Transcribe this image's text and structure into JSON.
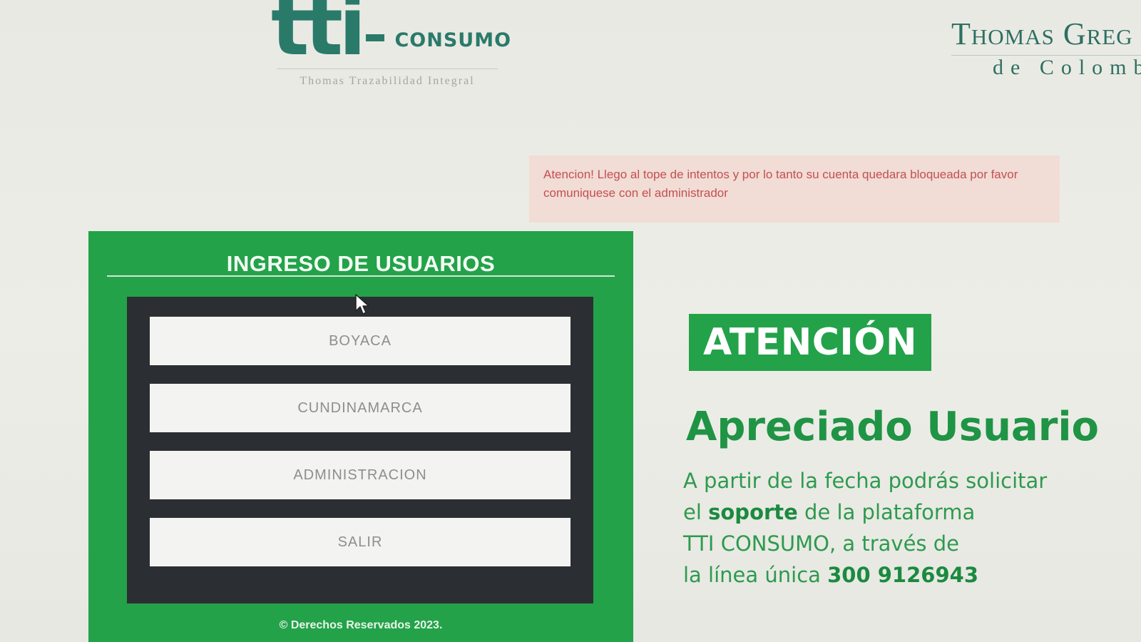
{
  "header": {
    "logo_main": "tti",
    "logo_product": "CONSUMO",
    "logo_subtitle": "Thomas Trazabilidad Integral",
    "company_name": "Thomas Greg",
    "company_sub": "de Colomb"
  },
  "alert": {
    "message": "Atencion! Llego al tope de intentos y por lo tanto su cuenta quedara bloqueada por favor comuniquese con el administrador"
  },
  "login": {
    "title": "INGRESO DE USUARIOS",
    "buttons": [
      {
        "label": "BOYACA"
      },
      {
        "label": "CUNDINAMARCA"
      },
      {
        "label": "ADMINISTRACION"
      },
      {
        "label": "SALIR"
      }
    ],
    "footer": "© Derechos Reservados 2023."
  },
  "notice": {
    "badge": "ATENCIÓN",
    "heading": "Apreciado Usuario",
    "line1": "A partir de la fecha podrás solicitar",
    "line2_pre": "el ",
    "line2_bold": "soporte",
    "line2_post": " de la plataforma",
    "line3": "TTI CONSUMO, a través de",
    "line4_pre": "la línea única ",
    "phone": "300 9126943"
  },
  "colors": {
    "brand_green": "#23a24a",
    "logo_teal": "#2a7a6a",
    "alert_bg": "#f1dcd6",
    "alert_text": "#c45050"
  }
}
